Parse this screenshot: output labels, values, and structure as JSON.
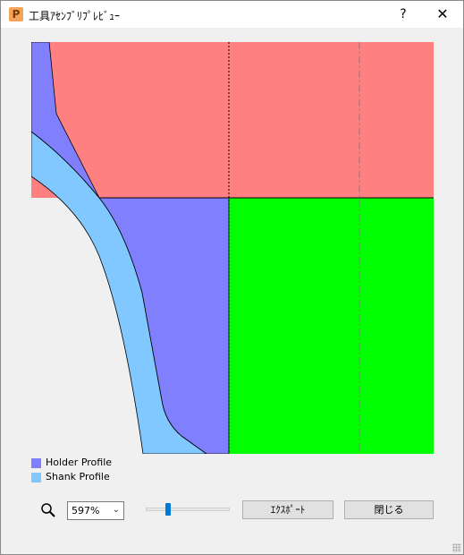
{
  "window": {
    "title": "工具ｱｾﾝﾌﾞﾘﾌﾟﾚﾋﾞｭｰ",
    "app_icon_letter": "P",
    "help_label": "?",
    "close_label": "✕"
  },
  "preview": {
    "colors": {
      "holder": "#8080ff",
      "shank": "#80c8ff",
      "cutter_red": "#ff8080",
      "cutter_green": "#00ff00",
      "outline": "#000000",
      "centerline": "#808080"
    }
  },
  "legend": {
    "items": [
      {
        "label": "Holder Profile",
        "color": "#8080ff"
      },
      {
        "label": "Shank Profile",
        "color": "#80c8ff"
      }
    ]
  },
  "controls": {
    "zoom_icon": "magnifier-icon",
    "zoom_value": "597%",
    "zoom_level": 0.25,
    "export_label": "ｴｸｽﾎﾟｰﾄ",
    "close_label": "閉じる"
  }
}
